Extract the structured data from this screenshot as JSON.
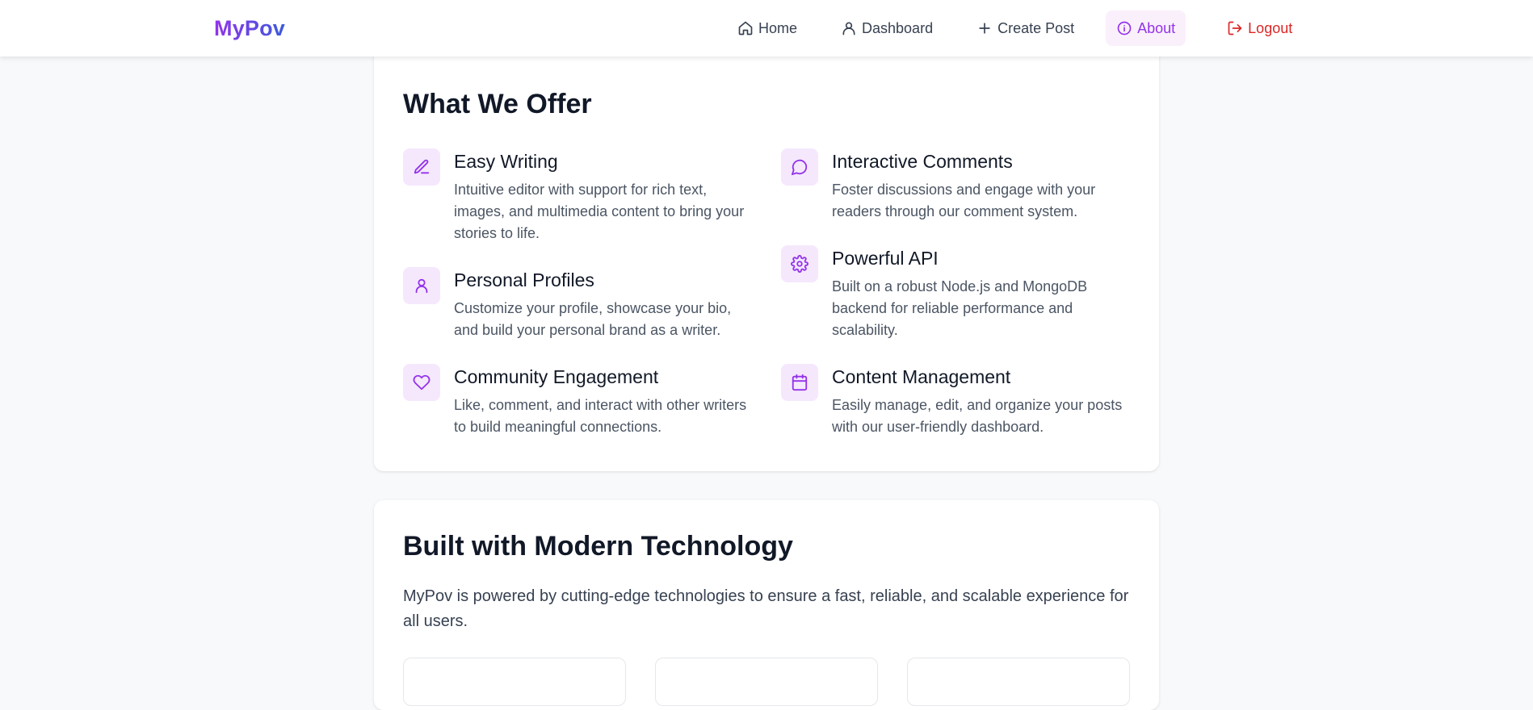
{
  "brand": {
    "name": "MyPov",
    "gradient_start": "#9333ea",
    "gradient_end": "#3b5bdb"
  },
  "nav": {
    "items": [
      {
        "label": "Home",
        "icon": "home-icon"
      },
      {
        "label": "Dashboard",
        "icon": "user-icon"
      },
      {
        "label": "Create Post",
        "icon": "plus-icon"
      },
      {
        "label": "About",
        "icon": "info-icon",
        "active": true
      },
      {
        "label": "Logout",
        "icon": "logout-icon"
      }
    ]
  },
  "colors": {
    "accent": "#9333ea",
    "accent_bg": "#f5e8fd",
    "logout": "#dc2626",
    "page_bg": "#f8f9fb"
  },
  "offer": {
    "title": "What We Offer",
    "features": [
      {
        "title": "Easy Writing",
        "icon": "pencil-icon",
        "desc": "Intuitive editor with support for rich text, images, and multimedia content to bring your stories to life."
      },
      {
        "title": "Interactive Comments",
        "icon": "message-circle-icon",
        "desc": "Foster discussions and engage with your readers through our comment system."
      },
      {
        "title": "Personal Profiles",
        "icon": "user-icon",
        "desc": "Customize your profile, showcase your bio, and build your personal brand as a writer."
      },
      {
        "title": "Powerful API",
        "icon": "gear-icon",
        "desc": "Built on a robust Node.js and MongoDB backend for reliable performance and scalability."
      },
      {
        "title": "Community Engagement",
        "icon": "heart-icon",
        "desc": "Like, comment, and interact with other writers to build meaningful connections."
      },
      {
        "title": "Content Management",
        "icon": "calendar-icon",
        "desc": "Easily manage, edit, and organize your posts with our user-friendly dashboard."
      }
    ]
  },
  "tech": {
    "title": "Built with Modern Technology",
    "desc": "MyPov is powered by cutting-edge technologies to ensure a fast, reliable, and scalable experience for all users."
  }
}
